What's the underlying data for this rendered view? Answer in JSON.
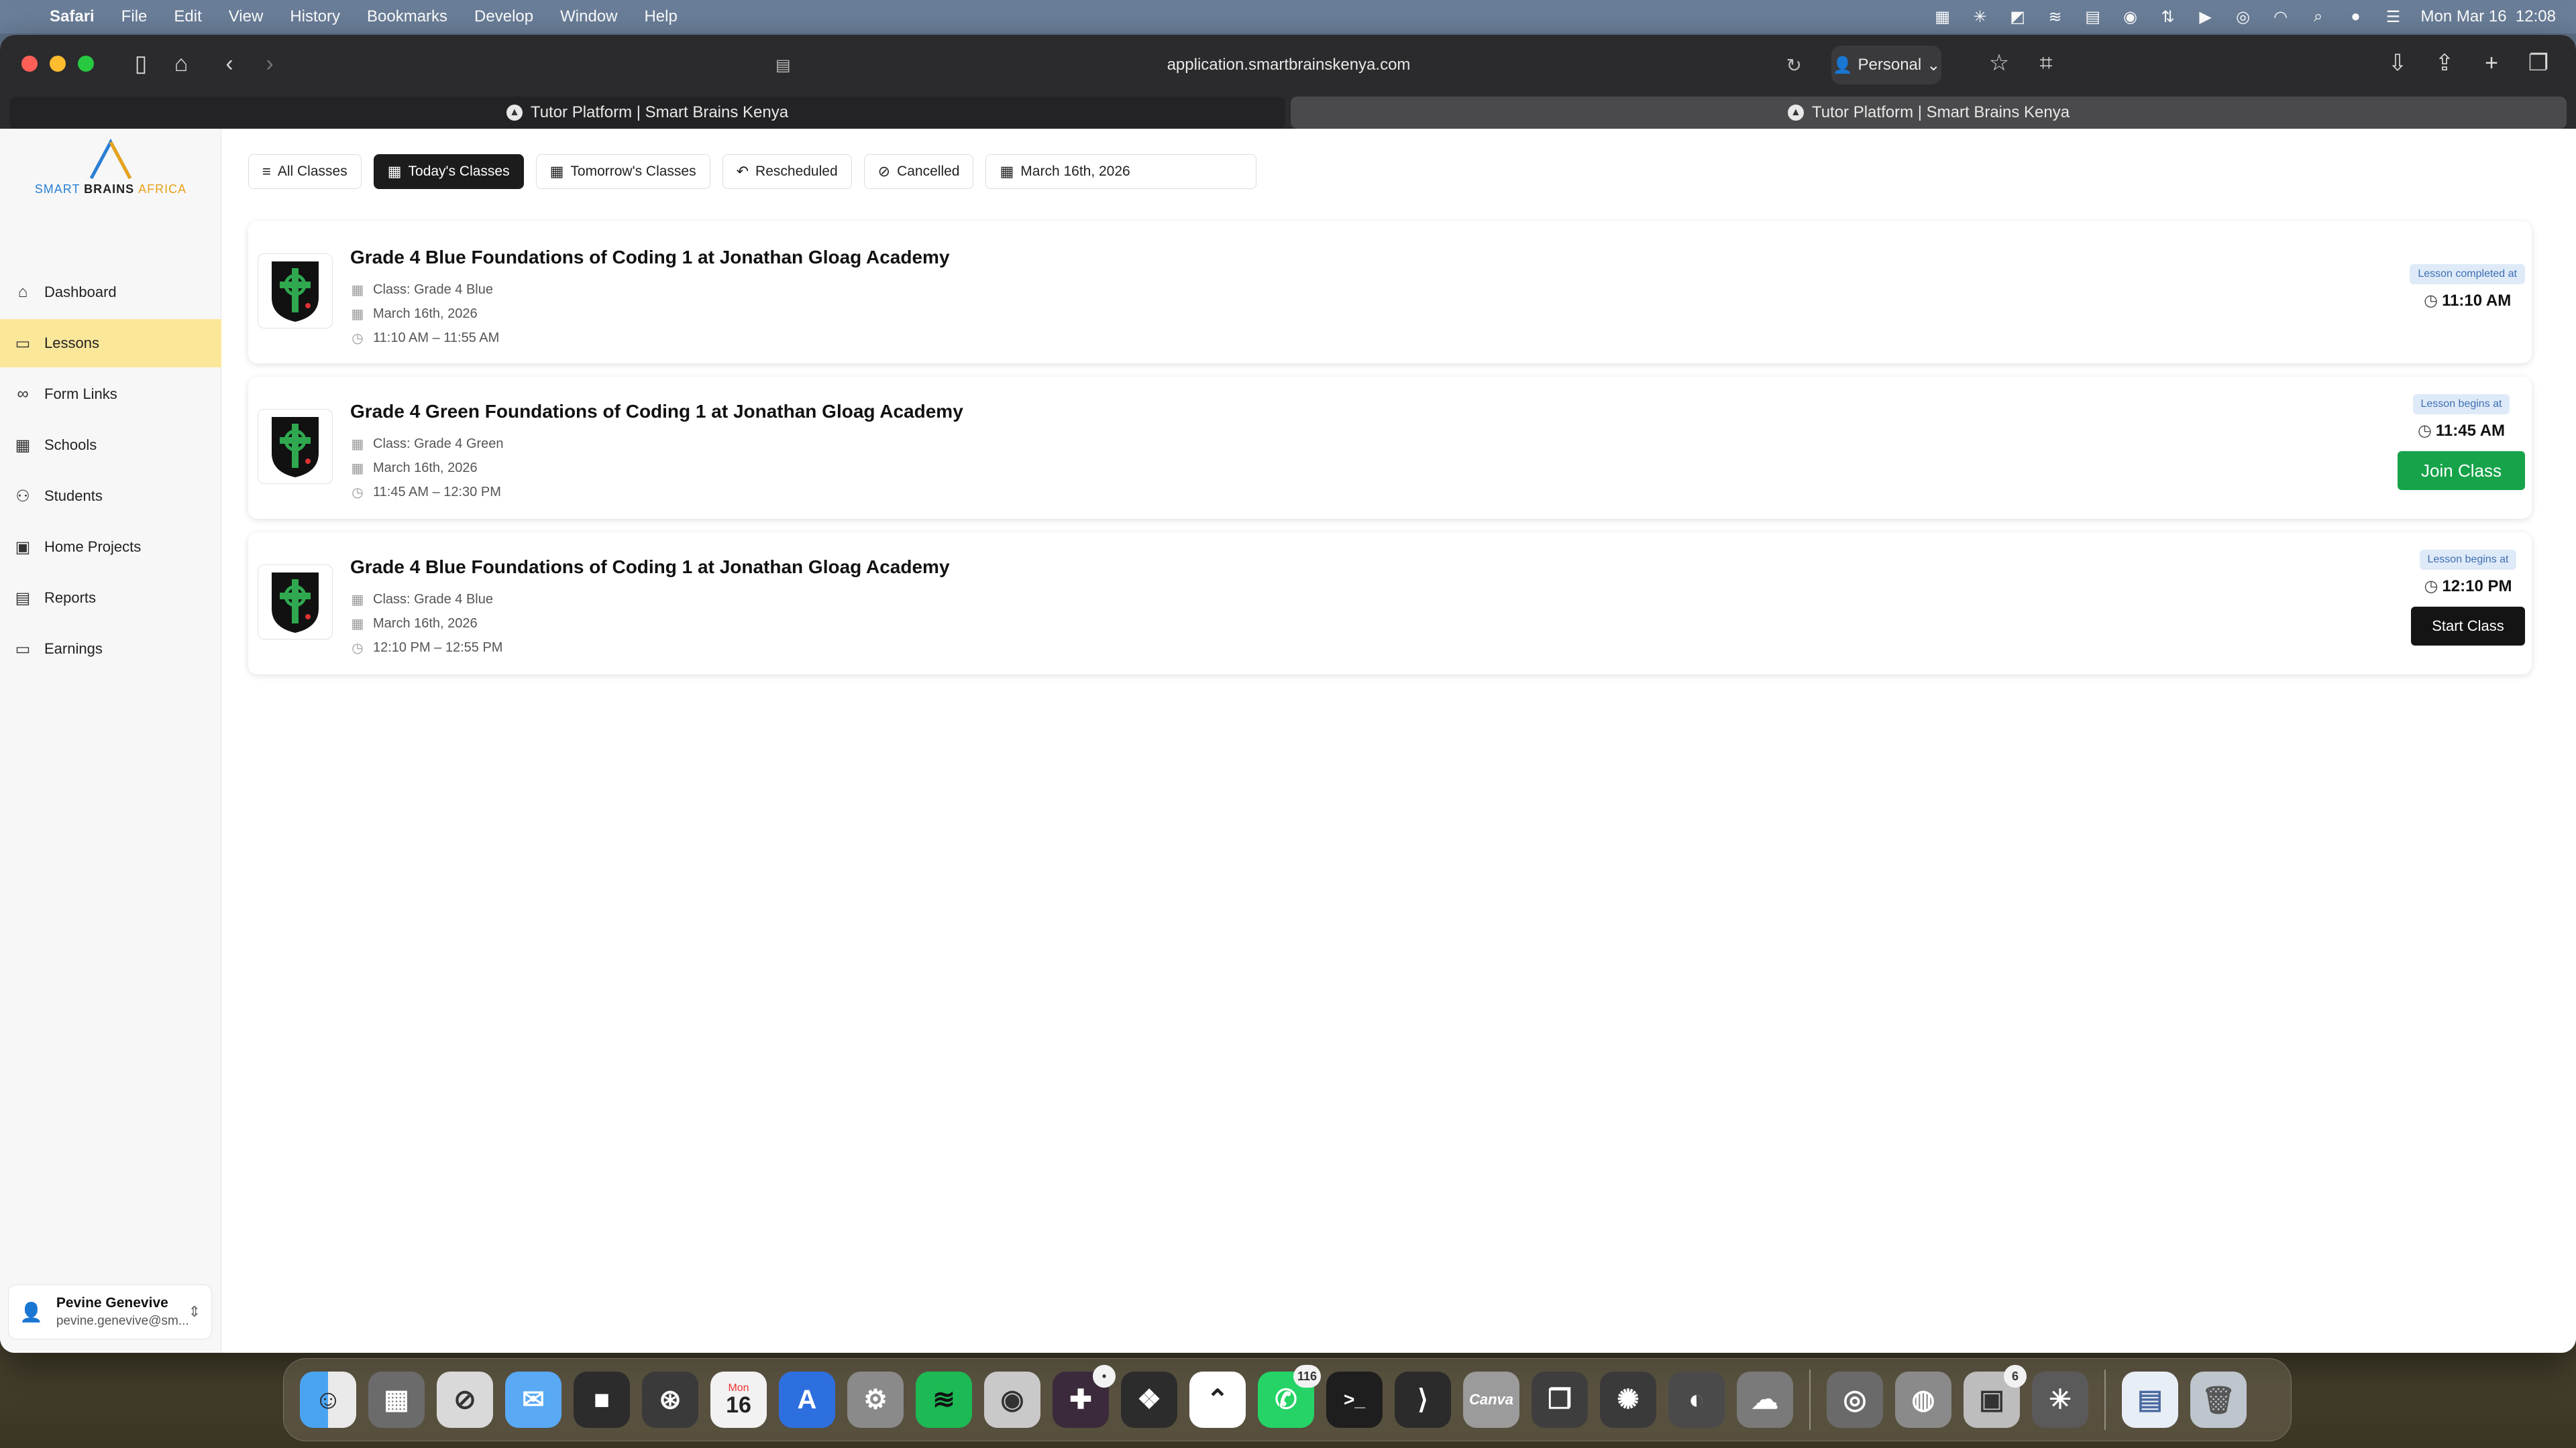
{
  "menubar": {
    "app_name": "Safari",
    "menus": [
      "File",
      "Edit",
      "View",
      "History",
      "Bookmarks",
      "Develop",
      "Window",
      "Help"
    ],
    "clock": "Mon Mar 16  12:08"
  },
  "browser": {
    "address": "application.smartbrainskenya.com",
    "profile": "Personal",
    "tabs": [
      {
        "title": "Tutor Platform | Smart Brains Kenya"
      },
      {
        "title": "Tutor Platform | Smart Brains Kenya"
      }
    ]
  },
  "sidebar": {
    "logo": {
      "part1": "SMART ",
      "part2": "BRAINS ",
      "part3": "AFRICA"
    },
    "items": [
      {
        "label": "Dashboard",
        "icon": "home-icon"
      },
      {
        "label": "Lessons",
        "icon": "book-icon"
      },
      {
        "label": "Form Links",
        "icon": "link-icon"
      },
      {
        "label": "Schools",
        "icon": "building-icon"
      },
      {
        "label": "Students",
        "icon": "users-icon"
      },
      {
        "label": "Home Projects",
        "icon": "folder-icon"
      },
      {
        "label": "Reports",
        "icon": "document-icon"
      },
      {
        "label": "Earnings",
        "icon": "wallet-icon"
      }
    ],
    "active_item": "Lessons",
    "user": {
      "name": "Pevine Genevive",
      "email": "pevine.genevive@sm..."
    }
  },
  "filters": {
    "all": "All Classes",
    "today": "Today's Classes",
    "tomorrow": "Tomorrow's Classes",
    "rescheduled": "Rescheduled",
    "cancelled": "Cancelled",
    "date": "March 16th, 2026",
    "active": "Today's Classes"
  },
  "lessons": [
    {
      "title": "Grade 4 Blue Foundations of Coding 1 at Jonathan Gloag Academy",
      "class": "Class: Grade 4 Blue",
      "date": "March 16th, 2026",
      "time": "11:10 AM – 11:55 AM",
      "status": "Lesson completed at",
      "status_time": "11:10 AM"
    },
    {
      "title": "Grade 4 Green Foundations of Coding 1 at Jonathan Gloag Academy",
      "class": "Class: Grade 4 Green",
      "date": "March 16th, 2026",
      "time": "11:45 AM – 12:30 PM",
      "status": "Lesson begins at",
      "status_time": "11:45 AM",
      "action": "Join Class"
    },
    {
      "title": "Grade 4 Blue Foundations of Coding 1 at Jonathan Gloag Academy",
      "class": "Class: Grade 4 Blue",
      "date": "March 16th, 2026",
      "time": "12:10 PM – 12:55 PM",
      "status": "Lesson begins at",
      "status_time": "12:10 PM",
      "action": "Start Class"
    }
  ],
  "dock": {
    "calendar_day": "Mon",
    "calendar_date": "16",
    "canva_label": "Canva",
    "whatsapp_badge": "116",
    "app_badge": "6",
    "colors": {
      "accent_green": "#16a34a",
      "nav_active": "#fbe79a",
      "badge_bg": "#dfeaf8"
    }
  }
}
